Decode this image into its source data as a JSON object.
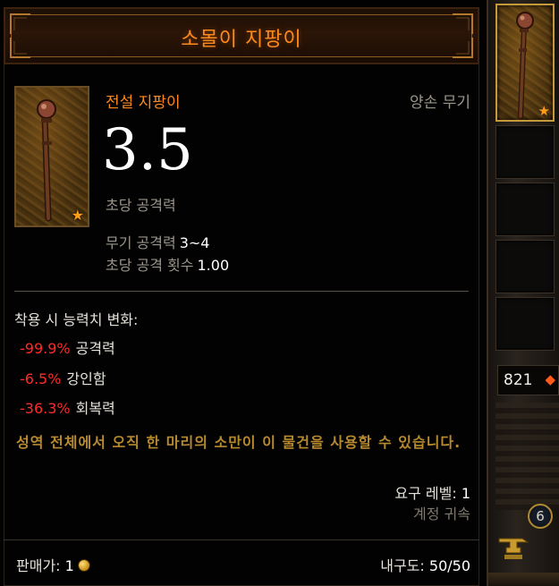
{
  "header": {
    "title": "소몰이 지팡이"
  },
  "item": {
    "name": "전설 지팡이",
    "type": "양손 무기",
    "dps": "3.5",
    "dps_label": "초당 공격력",
    "damage_label": "무기 공격력",
    "damage_value": "3~4",
    "aps_label": "초당 공격 횟수",
    "aps_value": "1.00",
    "icon": "staff-icon",
    "rarity_icon": "star-icon"
  },
  "equip": {
    "title": "착용 시 능력치 변화:",
    "changes": [
      {
        "value": "-99.9%",
        "stat": "공격력"
      },
      {
        "value": "-6.5%",
        "stat": "강인함"
      },
      {
        "value": "-36.3%",
        "stat": "회복력"
      }
    ]
  },
  "flavor": "성역 전체에서 오직 한 마리의 소만이 이 물건을 사용할 수 있습니다.",
  "requirement": {
    "label": "요구 레벨:",
    "value": "1"
  },
  "binding": "계정 귀속",
  "footer": {
    "sell_label": "판매가:",
    "sell_value": "1",
    "durability_label": "내구도:",
    "durability_value": "50/50"
  },
  "sidebar": {
    "gold": "821",
    "level_badge": "6"
  },
  "colors": {
    "legendary": "#ff8a1c",
    "negative": "#ff2a2a",
    "flavor": "#b88a2e"
  }
}
